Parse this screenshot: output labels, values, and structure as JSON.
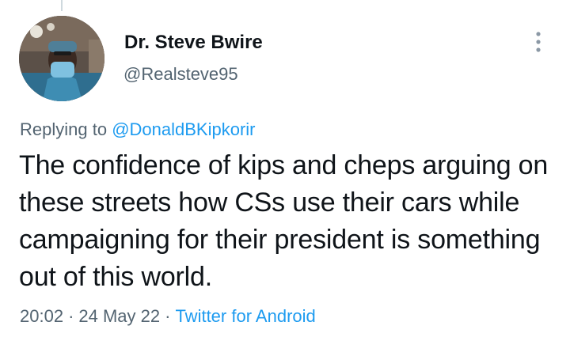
{
  "tweet": {
    "author_name": "Dr. Steve Bwire",
    "author_handle": "@Realsteve95",
    "replying_prefix": "Replying to",
    "replying_to": "@DonaldBKipkorir",
    "text": "The confidence of kips and cheps arguing on these streets how CSs use their cars while campaigning for their president is something out of this world.",
    "time": "20:02",
    "separator": "·",
    "date": "24 May 22",
    "source": "Twitter for Android"
  },
  "icons": {
    "more": "more-vertical-icon",
    "avatar": "profile-photo"
  },
  "colors": {
    "text": "#0f1419",
    "secondary": "#536471",
    "link": "#1d9bf0",
    "background": "#ffffff"
  }
}
